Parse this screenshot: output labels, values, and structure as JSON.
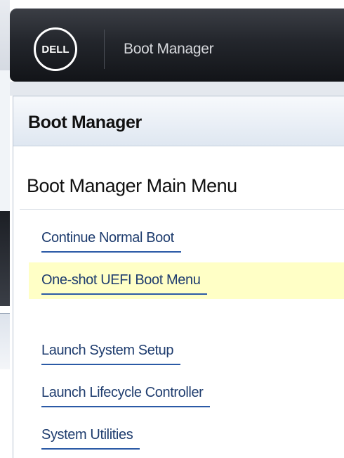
{
  "header": {
    "logo_text": "DELL",
    "title": "Boot Manager"
  },
  "panel": {
    "title": "Boot Manager",
    "section_title": "Boot Manager Main Menu",
    "menu_items": [
      {
        "label": "Continue Normal Boot",
        "selected": false
      },
      {
        "label": "One-shot UEFI Boot Menu",
        "selected": true
      },
      {
        "label": "Launch System Setup",
        "selected": false
      },
      {
        "label": "Launch Lifecycle Controller",
        "selected": false
      },
      {
        "label": "System Utilities",
        "selected": false
      }
    ]
  },
  "colors": {
    "header_bg": "#23262c",
    "selected_bg": "#ffffc6",
    "link_text": "#1e3c6e",
    "link_underline": "#2b5aa6"
  },
  "icons": {
    "logo": "dell-logo-icon"
  }
}
